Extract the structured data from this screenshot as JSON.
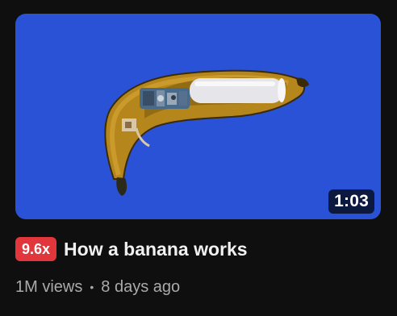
{
  "video": {
    "duration": "1:03",
    "badge": "9.6x",
    "title": "How a banana works",
    "views": "1M views",
    "separator": "•",
    "age": "8 days ago"
  },
  "colors": {
    "thumbnail_background": "#2a52d6",
    "badge_background": "#e0363c",
    "page_background": "#0f0f0f",
    "meta_text": "#aaaaaa"
  }
}
